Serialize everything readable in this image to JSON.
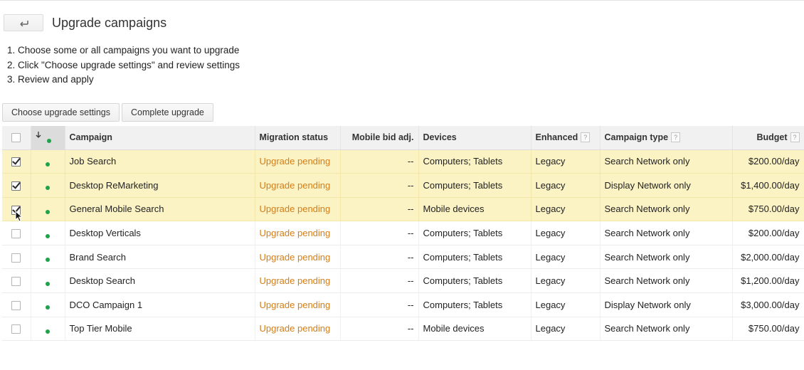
{
  "page": {
    "title": "Upgrade campaigns",
    "steps": [
      "1. Choose some or all campaigns you want to upgrade",
      "2. Click \"Choose upgrade settings\" and review settings",
      "3. Review and apply"
    ]
  },
  "toolbar": {
    "choose_label": "Choose upgrade settings",
    "complete_label": "Complete upgrade"
  },
  "table": {
    "headers": {
      "campaign": "Campaign",
      "migration_status": "Migration status",
      "mobile_bid": "Mobile bid adj.",
      "devices": "Devices",
      "enhanced": "Enhanced",
      "campaign_type": "Campaign type",
      "budget": "Budget"
    },
    "help_glyph": "?",
    "rows": [
      {
        "checked": true,
        "campaign": "Job Search",
        "status": "Upgrade pending",
        "mobile_bid": "--",
        "devices": "Computers; Tablets",
        "enhanced": "Legacy",
        "type": "Search Network only",
        "budget": "$200.00/day"
      },
      {
        "checked": true,
        "campaign": "Desktop ReMarketing",
        "status": "Upgrade pending",
        "mobile_bid": "--",
        "devices": "Computers; Tablets",
        "enhanced": "Legacy",
        "type": "Display Network only",
        "budget": "$1,400.00/day"
      },
      {
        "checked": true,
        "campaign": "General Mobile Search",
        "status": "Upgrade pending",
        "mobile_bid": "--",
        "devices": "Mobile devices",
        "enhanced": "Legacy",
        "type": "Search Network only",
        "budget": "$750.00/day"
      },
      {
        "checked": false,
        "campaign": "Desktop Verticals",
        "status": "Upgrade pending",
        "mobile_bid": "--",
        "devices": "Computers; Tablets",
        "enhanced": "Legacy",
        "type": "Search Network only",
        "budget": "$200.00/day"
      },
      {
        "checked": false,
        "campaign": "Brand Search",
        "status": "Upgrade pending",
        "mobile_bid": "--",
        "devices": "Computers; Tablets",
        "enhanced": "Legacy",
        "type": "Search Network only",
        "budget": "$2,000.00/day"
      },
      {
        "checked": false,
        "campaign": "Desktop Search",
        "status": "Upgrade pending",
        "mobile_bid": "--",
        "devices": "Computers; Tablets",
        "enhanced": "Legacy",
        "type": "Search Network only",
        "budget": "$1,200.00/day"
      },
      {
        "checked": false,
        "campaign": "DCO Campaign 1",
        "status": "Upgrade pending",
        "mobile_bid": "--",
        "devices": "Computers; Tablets",
        "enhanced": "Legacy",
        "type": "Display Network only",
        "budget": "$3,000.00/day"
      },
      {
        "checked": false,
        "campaign": "Top Tier Mobile",
        "status": "Upgrade pending",
        "mobile_bid": "--",
        "devices": "Mobile devices",
        "enhanced": "Legacy",
        "type": "Search Network only",
        "budget": "$750.00/day"
      }
    ]
  },
  "colors": {
    "selected_row": "#fcf3c5",
    "status_pending": "#d27e1a",
    "enabled_dot": "#1fa24a"
  },
  "icons": [
    "back-arrow-icon",
    "sort-down-arrow-icon",
    "status-dot-icon",
    "help-icon",
    "mouse-cursor-icon"
  ]
}
